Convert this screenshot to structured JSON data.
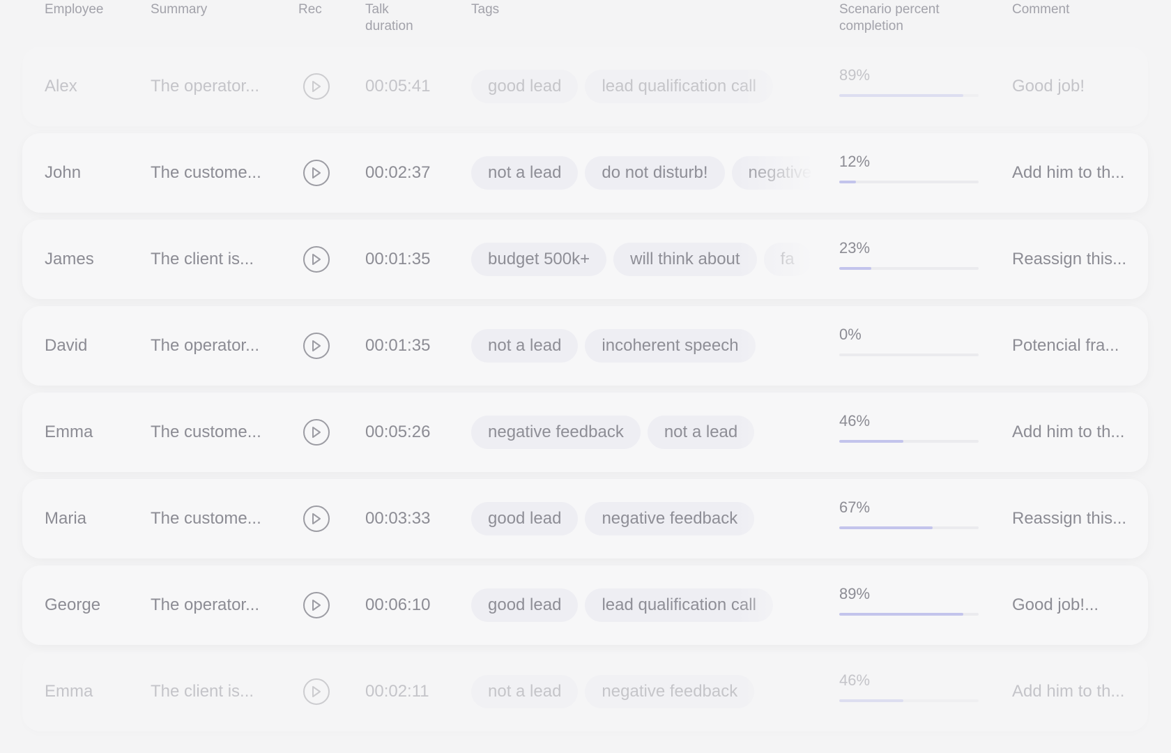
{
  "header": {
    "employee": "Employee",
    "summary": "Summary",
    "rec": "Rec",
    "talk_duration_1": "Talk",
    "talk_duration_2": "duration",
    "tags": "Tags",
    "scenario_1": "Scenario percent",
    "scenario_2": "completion",
    "comment": "Comment"
  },
  "icons": {
    "rec": "play-icon"
  },
  "colors": {
    "progress": "#c3c4ec",
    "tag_bg": "#eeeef3",
    "row_bg": "#f7f7f8"
  },
  "rows": [
    {
      "employee": "Alex",
      "summary": "The operator...",
      "duration": "00:05:41",
      "tags": [
        "good lead",
        "lead qualification call"
      ],
      "percent": "89%",
      "progress": 0.89,
      "comment": "Good job!"
    },
    {
      "employee": "John",
      "summary": "The custome...",
      "duration": "00:02:37",
      "tags": [
        "not a lead",
        "do not disturb!",
        "negative feedback"
      ],
      "percent": "12%",
      "progress": 0.12,
      "comment": "Add him to th..."
    },
    {
      "employee": "James",
      "summary": "The client is...",
      "duration": "00:01:35",
      "tags": [
        "budget 500k+",
        "will think about",
        "fa"
      ],
      "percent": "23%",
      "progress": 0.23,
      "comment": "Reassign this..."
    },
    {
      "employee": "David",
      "summary": "The operator...",
      "duration": "00:01:35",
      "tags": [
        "not a lead",
        "incoherent speech"
      ],
      "percent": "0%",
      "progress": 0.0,
      "comment": "Potencial fra..."
    },
    {
      "employee": "Emma",
      "summary": "The custome...",
      "duration": "00:05:26",
      "tags": [
        "negative feedback",
        "not a lead"
      ],
      "percent": "46%",
      "progress": 0.46,
      "comment": "Add him to th..."
    },
    {
      "employee": "Maria",
      "summary": "The custome...",
      "duration": "00:03:33",
      "tags": [
        "good lead",
        "negative feedback"
      ],
      "percent": "67%",
      "progress": 0.67,
      "comment": "Reassign this..."
    },
    {
      "employee": "George",
      "summary": "The operator...",
      "duration": "00:06:10",
      "tags": [
        "good lead",
        "lead qualification call"
      ],
      "percent": "89%",
      "progress": 0.89,
      "comment": "Good job!..."
    },
    {
      "employee": "Emma",
      "summary": "The client is...",
      "duration": "00:02:11",
      "tags": [
        "not a lead",
        "negative feedback"
      ],
      "percent": "46%",
      "progress": 0.46,
      "comment": "Add him to th..."
    }
  ]
}
